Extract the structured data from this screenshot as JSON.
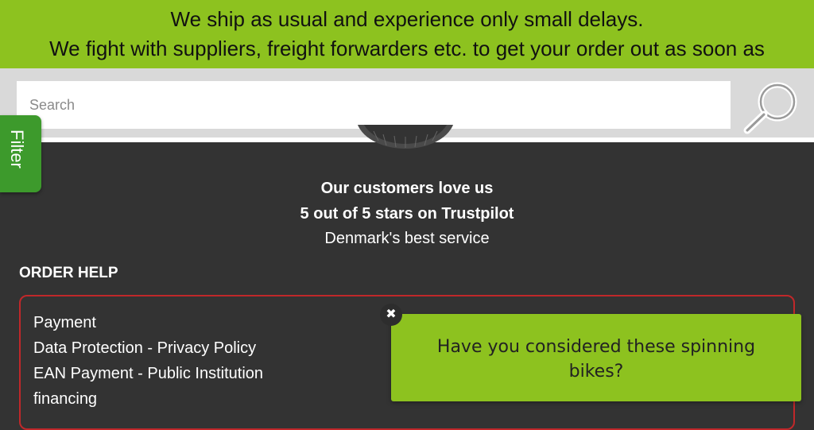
{
  "banner": {
    "line1": "We ship as usual and experience only small delays.",
    "line2": "We fight with suppliers, freight forwarders etc. to get your order out as soon as"
  },
  "search": {
    "placeholder": "Search"
  },
  "filter": {
    "label": "Filter"
  },
  "trustpilot": {
    "line1": "Our customers love us",
    "line2": "5 out of 5 stars on Trustpilot",
    "line3": "Denmark's best service"
  },
  "order_help": {
    "heading": "ORDER HELP",
    "links": [
      "Payment",
      "Data Protection - Privacy Policy",
      "EAN Payment - Public Institution",
      "financing"
    ]
  },
  "popup": {
    "message": "Have you considered these spinning bikes?",
    "close_icon": "✖"
  },
  "colors": {
    "accent_green": "#8dc21f",
    "filter_green": "#3d9a2c",
    "background": "#333333",
    "box_border": "#c0282a"
  },
  "icons": {
    "search": "magnifier-icon",
    "close": "close-icon"
  }
}
